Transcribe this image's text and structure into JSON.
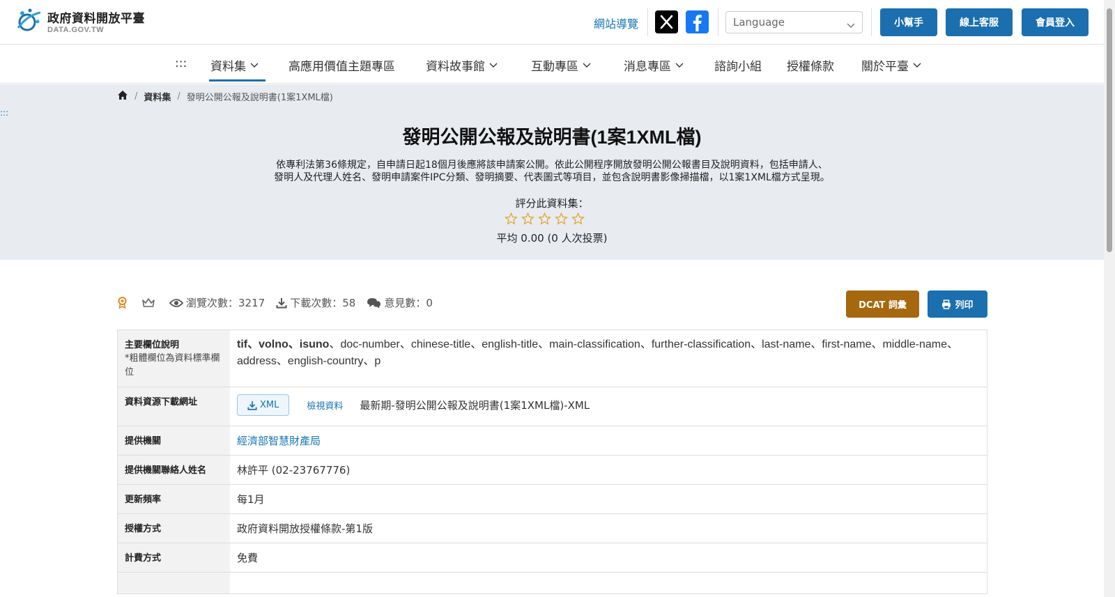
{
  "header": {
    "logo_title": "政府資料開放平臺",
    "logo_sub": "DATA.GOV.TW",
    "sitemap": "網站導覽",
    "language_placeholder": "Language",
    "buttons": [
      "小幫手",
      "線上客服",
      "會員登入"
    ]
  },
  "nav": {
    "menu_glyph": ":::",
    "items": [
      "資料集",
      "高應用價值主題專區",
      "資料故事館",
      "互動專區",
      "消息專區",
      "諮詢小組",
      "授權條款",
      "關於平臺"
    ]
  },
  "breadcrumb": {
    "items": [
      "資料集",
      "發明公開公報及說明書(1案1XML檔)"
    ]
  },
  "side_dots": ":::",
  "dataset": {
    "title": "發明公開公報及說明書(1案1XML檔)",
    "description_line1": "依專利法第36條規定，自申請日起18個月後應將該申請案公開。依此公開程序開放發明公開公報書目及說明資料，包括申請人、",
    "description_line2": "發明人及代理人姓名、發明申請案件IPC分類、發明摘要、代表圖式等項目，並包含說明書影像掃描檔，以1案1XML檔方式呈現。",
    "rate_label": "評分此資料集：",
    "rating": 0,
    "rating_max": 5,
    "average": "平均 0.00 (0 人次投票)"
  },
  "stats": {
    "views_label": "瀏覽次數：",
    "views": "3217",
    "downloads_label": "下載次數：",
    "downloads": "58",
    "comments_label": "意見數：",
    "comments": "0"
  },
  "actions": {
    "dcat": "DCAT 詞彙",
    "print": "列印"
  },
  "table": {
    "fields_label": "主要欄位說明",
    "fields_note": "*粗體欄位為資料標準欄位",
    "fields_bold": "tif、volno、isuno",
    "fields_rest": "、doc-number、chinese-title、english-title、main-classification、further-classification、last-name、first-name、middle-name、address、english-country、p",
    "download_label": "資料資源下載網址",
    "xml_button": "XML",
    "view_data": "檢視資料",
    "resource_name": "最新期-發明公開公報及說明書(1案1XML檔)-XML",
    "provider_label": "提供機關",
    "provider": "經濟部智慧財產局",
    "contact_label": "提供機關聯絡人姓名",
    "contact": "林許平 (02-23767776)",
    "frequency_label": "更新頻率",
    "frequency": "每1月",
    "license_label": "授權方式",
    "license": "政府資料開放授權條款-第1版",
    "fee_label": "計費方式",
    "fee": "免費"
  },
  "colors": {
    "primary": "#1b6fae",
    "link": "#1574b5",
    "dcat": "#a5680f",
    "hero_bg": "#e8ecf1",
    "star": "#e0a526"
  }
}
